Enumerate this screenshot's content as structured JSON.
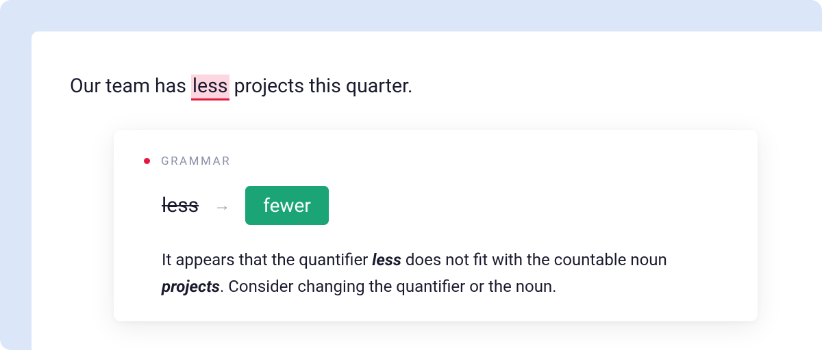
{
  "sentence": {
    "before": "Our team has ",
    "error": "less",
    "after": " projects this quarter."
  },
  "suggestion": {
    "category": "GRAMMAR",
    "original": "less",
    "replacement": "fewer",
    "explanation": {
      "part1": "It appears that the quantifier ",
      "word1": "less",
      "part2": " does not fit with the countable noun ",
      "word2": "projects",
      "part3": ". Consider changing the quantifier or the noun."
    }
  },
  "colors": {
    "accent_red": "#e6173f",
    "accent_green": "#1ba576",
    "highlight_pink": "#fcd7df",
    "background_blue": "#dbe6f8"
  }
}
